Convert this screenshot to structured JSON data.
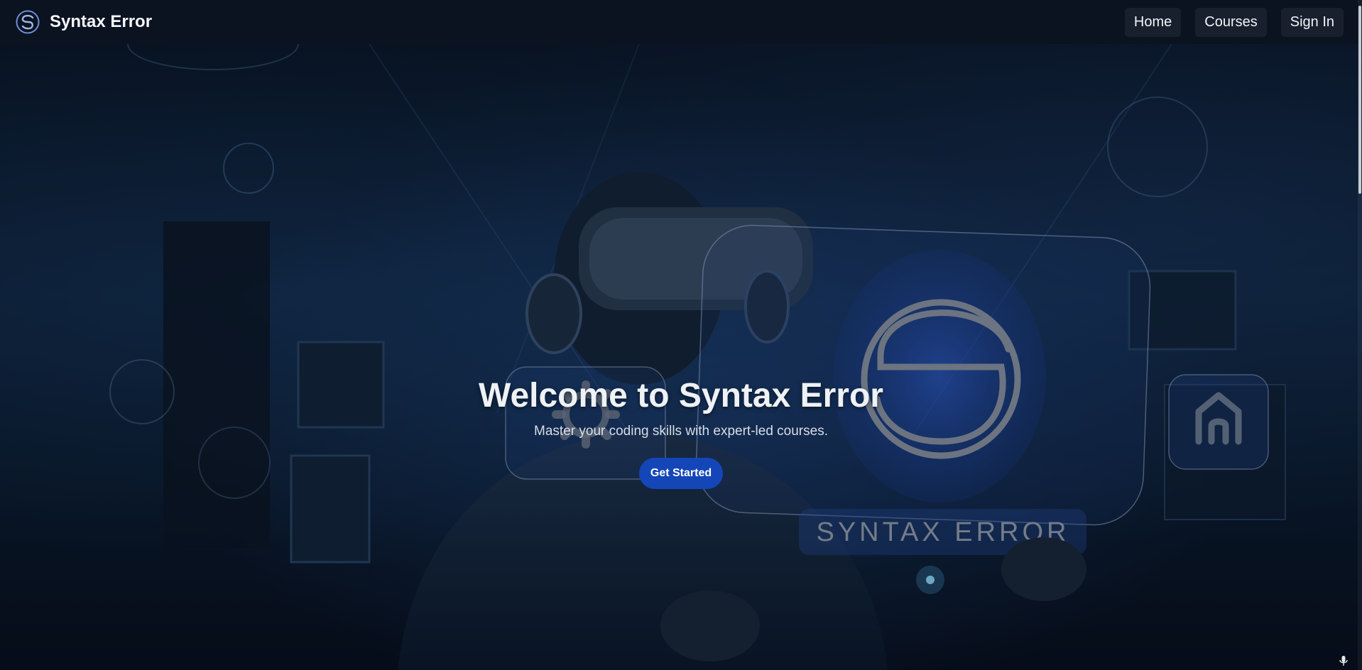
{
  "brand": {
    "name": "Syntax Error",
    "logo_icon": "syntax-error-logo-icon"
  },
  "nav": {
    "items": [
      {
        "label": "Home"
      },
      {
        "label": "Courses"
      },
      {
        "label": "Sign In"
      }
    ]
  },
  "hero": {
    "title": "Welcome to Syntax Error",
    "subtitle": "Master your coding skills with expert-led courses.",
    "cta_label": "Get Started",
    "panel_wordmark": "SYNTAX ERROR",
    "icons": [
      "gear-icon",
      "home-icon"
    ]
  },
  "colors": {
    "nav_bg": "#0b1220",
    "nav_item_bg": "#18202e",
    "cta_bg": "#1446b8",
    "title": "#eef1f5"
  }
}
